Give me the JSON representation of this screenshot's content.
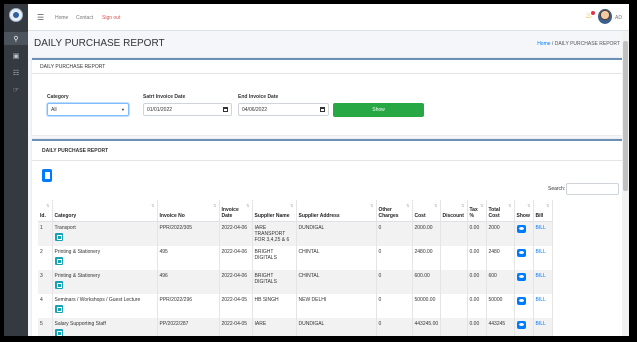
{
  "nav": {
    "home": "Home",
    "contact": "Contact",
    "signout": "Sign out",
    "user": "AD"
  },
  "page": {
    "title": "DAILY PURCHASE REPORT",
    "breadcrumb_home": "Home",
    "breadcrumb_sep": " / ",
    "breadcrumb_current": "DAILY PURCHASE REPORT"
  },
  "filter": {
    "card_title": "DAILY PURCHASE REPORT",
    "category_label": "Category",
    "category_value": "All",
    "start_label": "Satrt Invoice Date",
    "start_value": "01/01/2022",
    "end_label": "End Invoice Date",
    "end_value": "04/06/2022",
    "show_label": "Show"
  },
  "report": {
    "title": "DAILY PURCHASE REPORT",
    "search_label": "Search:",
    "columns": [
      "Id.",
      "Category",
      "Invoice No",
      "Invoice Date",
      "Supplier Name",
      "Supplier Address",
      "Other Charges",
      "Cost",
      "Discount",
      "Tax %",
      "Total Cost",
      "Show",
      "Bill"
    ],
    "rows": [
      {
        "id": "1",
        "category": "Transport",
        "invoice_no": "PPR/2022/305",
        "date": "2022-04-06",
        "supplier": "IARE TRANSPORT FOR 3,4,25 & 6",
        "address": "DUNDIGAL",
        "other": "0",
        "cost": "2000.00",
        "discount": "",
        "tax": "0.00",
        "total": "2000",
        "bill": "BILL"
      },
      {
        "id": "2",
        "category": "Printing & Stationery",
        "invoice_no": "495",
        "date": "2022-04-06",
        "supplier": "BRIGHT DIGITALS",
        "address": "CHINTAL",
        "other": "0",
        "cost": "2480.00",
        "discount": "",
        "tax": "0.00",
        "total": "2480",
        "bill": "BILL"
      },
      {
        "id": "3",
        "category": "Printing & Stationery",
        "invoice_no": "496",
        "date": "2022-04-06",
        "supplier": "BRIGHT DIGITALS",
        "address": "CHINTAL",
        "other": "0",
        "cost": "600.00",
        "discount": "",
        "tax": "0.00",
        "total": "600",
        "bill": "BILL"
      },
      {
        "id": "4",
        "category": "Seminars / Workshops / Guest Lecture",
        "invoice_no": "PPR/2022/296",
        "date": "2022-04-05",
        "supplier": "HB SINGH",
        "address": "NEW DELHI",
        "other": "0",
        "cost": "50000.00",
        "discount": "",
        "tax": "0.00",
        "total": "50000",
        "bill": "BILL"
      },
      {
        "id": "5",
        "category": "Salary Supporting Staff",
        "invoice_no": "PP/2022/287",
        "date": "2022-04-05",
        "supplier": "IARE",
        "address": "DUNDIGAL",
        "other": "0",
        "cost": "443245.00",
        "discount": "",
        "tax": "0.00",
        "total": "443245",
        "bill": "BILL"
      }
    ]
  }
}
